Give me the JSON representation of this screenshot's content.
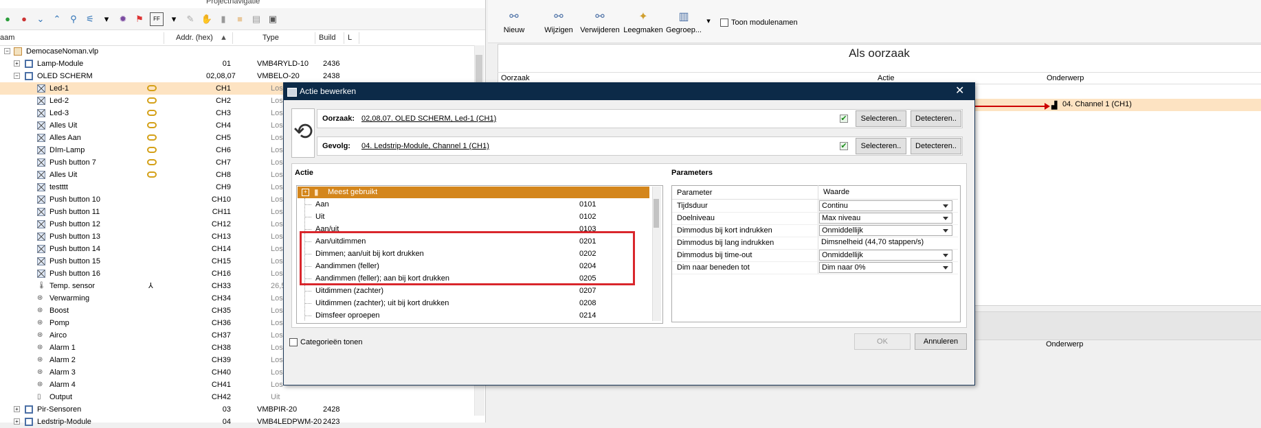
{
  "left": {
    "title": "Projectnavigatie",
    "columns": {
      "name": "aam",
      "addr": "Addr. (hex)",
      "type": "Type",
      "build": "Build",
      "l": "L"
    },
    "rows": [
      {
        "name": "DemocaseNoman.vlp",
        "addr": "",
        "type": "",
        "build": "",
        "indent": 0,
        "icon": "home-icon",
        "plus": "−"
      },
      {
        "name": "Lamp-Module",
        "addr": "01",
        "type": "VMB4RYLD-10",
        "build": "2436",
        "indent": 1,
        "icon": "module-icon",
        "plus": "+"
      },
      {
        "name": "OLED SCHERM",
        "addr": "02,08,07",
        "type": "VMBELO-20",
        "build": "2438",
        "indent": 1,
        "icon": "module-icon",
        "plus": "−"
      },
      {
        "name": "Led-1",
        "addr": "CH1",
        "type": "Los",
        "build": "",
        "indent": 2,
        "icon": "x",
        "link": true,
        "sel": true
      },
      {
        "name": "Led-2",
        "addr": "CH2",
        "type": "Los",
        "build": "",
        "indent": 2,
        "icon": "x",
        "link": true
      },
      {
        "name": "Led-3",
        "addr": "CH3",
        "type": "Los",
        "build": "",
        "indent": 2,
        "icon": "x",
        "link": true
      },
      {
        "name": "Alles Uit",
        "addr": "CH4",
        "type": "Los",
        "build": "",
        "indent": 2,
        "icon": "x",
        "link": true
      },
      {
        "name": "Alles Aan",
        "addr": "CH5",
        "type": "Los",
        "build": "",
        "indent": 2,
        "icon": "x",
        "link": true
      },
      {
        "name": "DIm-Lamp",
        "addr": "CH6",
        "type": "Los",
        "build": "",
        "indent": 2,
        "icon": "x",
        "link": true
      },
      {
        "name": "Push button 7",
        "addr": "CH7",
        "type": "Los",
        "build": "",
        "indent": 2,
        "icon": "x",
        "link": true
      },
      {
        "name": "Alles Uit",
        "addr": "CH8",
        "type": "Los",
        "build": "",
        "indent": 2,
        "icon": "x",
        "link": true
      },
      {
        "name": "testttt",
        "addr": "CH9",
        "type": "Los",
        "build": "",
        "indent": 2,
        "icon": "x"
      },
      {
        "name": "Push button 10",
        "addr": "CH10",
        "type": "Los",
        "build": "",
        "indent": 2,
        "icon": "x"
      },
      {
        "name": "Push button 11",
        "addr": "CH11",
        "type": "Los",
        "build": "",
        "indent": 2,
        "icon": "x"
      },
      {
        "name": "Push button 12",
        "addr": "CH12",
        "type": "Los",
        "build": "",
        "indent": 2,
        "icon": "x"
      },
      {
        "name": "Push button 13",
        "addr": "CH13",
        "type": "Los",
        "build": "",
        "indent": 2,
        "icon": "x"
      },
      {
        "name": "Push button 14",
        "addr": "CH14",
        "type": "Los",
        "build": "",
        "indent": 2,
        "icon": "x"
      },
      {
        "name": "Push button 15",
        "addr": "CH15",
        "type": "Los",
        "build": "",
        "indent": 2,
        "icon": "x"
      },
      {
        "name": "Push button 16",
        "addr": "CH16",
        "type": "Los",
        "build": "",
        "indent": 2,
        "icon": "x"
      },
      {
        "name": "Temp. sensor",
        "addr": "CH33",
        "type": "26,5 °",
        "build": "",
        "indent": 2,
        "icon": "thermo",
        "sensor": true
      },
      {
        "name": "Verwarming",
        "addr": "CH34",
        "type": "Los",
        "build": "",
        "indent": 2,
        "icon": "dot"
      },
      {
        "name": "Boost",
        "addr": "CH35",
        "type": "Los",
        "build": "",
        "indent": 2,
        "icon": "dot"
      },
      {
        "name": "Pomp",
        "addr": "CH36",
        "type": "Los",
        "build": "",
        "indent": 2,
        "icon": "dot"
      },
      {
        "name": "Airco",
        "addr": "CH37",
        "type": "Los",
        "build": "",
        "indent": 2,
        "icon": "dot"
      },
      {
        "name": "Alarm 1",
        "addr": "CH38",
        "type": "Los",
        "build": "",
        "indent": 2,
        "icon": "dot"
      },
      {
        "name": "Alarm 2",
        "addr": "CH39",
        "type": "Los",
        "build": "",
        "indent": 2,
        "icon": "dot"
      },
      {
        "name": "Alarm 3",
        "addr": "CH40",
        "type": "Los",
        "build": "",
        "indent": 2,
        "icon": "dot"
      },
      {
        "name": "Alarm 4",
        "addr": "CH41",
        "type": "Los",
        "build": "",
        "indent": 2,
        "icon": "dot"
      },
      {
        "name": "Output",
        "addr": "CH42",
        "type": "Uit",
        "build": "",
        "indent": 2,
        "icon": "out"
      },
      {
        "name": "Pir-Sensoren",
        "addr": "03",
        "type": "VMBPIR-20",
        "build": "2428",
        "indent": 1,
        "icon": "module-icon",
        "plus": "+"
      },
      {
        "name": "Ledstrip-Module",
        "addr": "04",
        "type": "VMB4LEDPWM-20",
        "build": "2423",
        "indent": 1,
        "icon": "module-icon",
        "plus": "+"
      }
    ]
  },
  "ribbon": {
    "buttons": [
      "Nieuw",
      "Wijzigen",
      "Verwijderen",
      "Leegmaken",
      "Gegroep..."
    ],
    "toon": "Toon modulenamen"
  },
  "right": {
    "header": "Als oorzaak",
    "cols": [
      "Oorzaak",
      "Actie",
      "Onderwerp"
    ],
    "channel": "04. Channel 1 (CH1)",
    "onderwerp2": "Onderwerp"
  },
  "dialog": {
    "title": "Actie bewerken",
    "oorzaak_label": "Oorzaak:",
    "oorzaak_value": "02,08,07. OLED SCHERM, Led-1 (CH1)",
    "gevolg_label": "Gevolg:",
    "gevolg_value": "04. Ledstrip-Module, Channel 1 (CH1)",
    "select": "Selecteren..",
    "detect": "Detecteren..",
    "actie_title": "Actie",
    "params_title": "Parameters",
    "group": "Meest gebruikt",
    "actions": [
      {
        "name": "Aan",
        "code": "0101"
      },
      {
        "name": "Uit",
        "code": "0102"
      },
      {
        "name": "Aan/uit",
        "code": "0103"
      },
      {
        "name": "Aan/uitdimmen",
        "code": "0201"
      },
      {
        "name": "Dimmen; aan/uit bij kort drukken",
        "code": "0202"
      },
      {
        "name": "Aandimmen (feller)",
        "code": "0204"
      },
      {
        "name": "Aandimmen (feller); aan bij kort drukken",
        "code": "0205"
      },
      {
        "name": "Uitdimmen (zachter)",
        "code": "0207"
      },
      {
        "name": "Uitdimmen (zachter); uit bij kort drukken",
        "code": "0208"
      },
      {
        "name": "Dimsfeer oproepen",
        "code": "0214"
      }
    ],
    "param_header": {
      "p": "Parameter",
      "w": "Waarde"
    },
    "params": [
      {
        "p": "Tijdsduur",
        "w": "Continu",
        "dd": true
      },
      {
        "p": "Doelniveau",
        "w": "Max niveau",
        "dd": true
      },
      {
        "p": "Dimmodus bij kort indrukken",
        "w": "Onmiddellijk",
        "dd": true
      },
      {
        "p": "Dimmodus bij lang indrukken",
        "w": "Dimsnelheid (44,70 stappen/s)",
        "dd": false
      },
      {
        "p": "Dimmodus bij time-out",
        "w": "Onmiddellijk",
        "dd": true
      },
      {
        "p": "Dim naar beneden tot",
        "w": "Dim naar 0%",
        "dd": true
      }
    ],
    "categories": "Categorieën tonen",
    "ok": "OK",
    "cancel": "Annuleren"
  }
}
